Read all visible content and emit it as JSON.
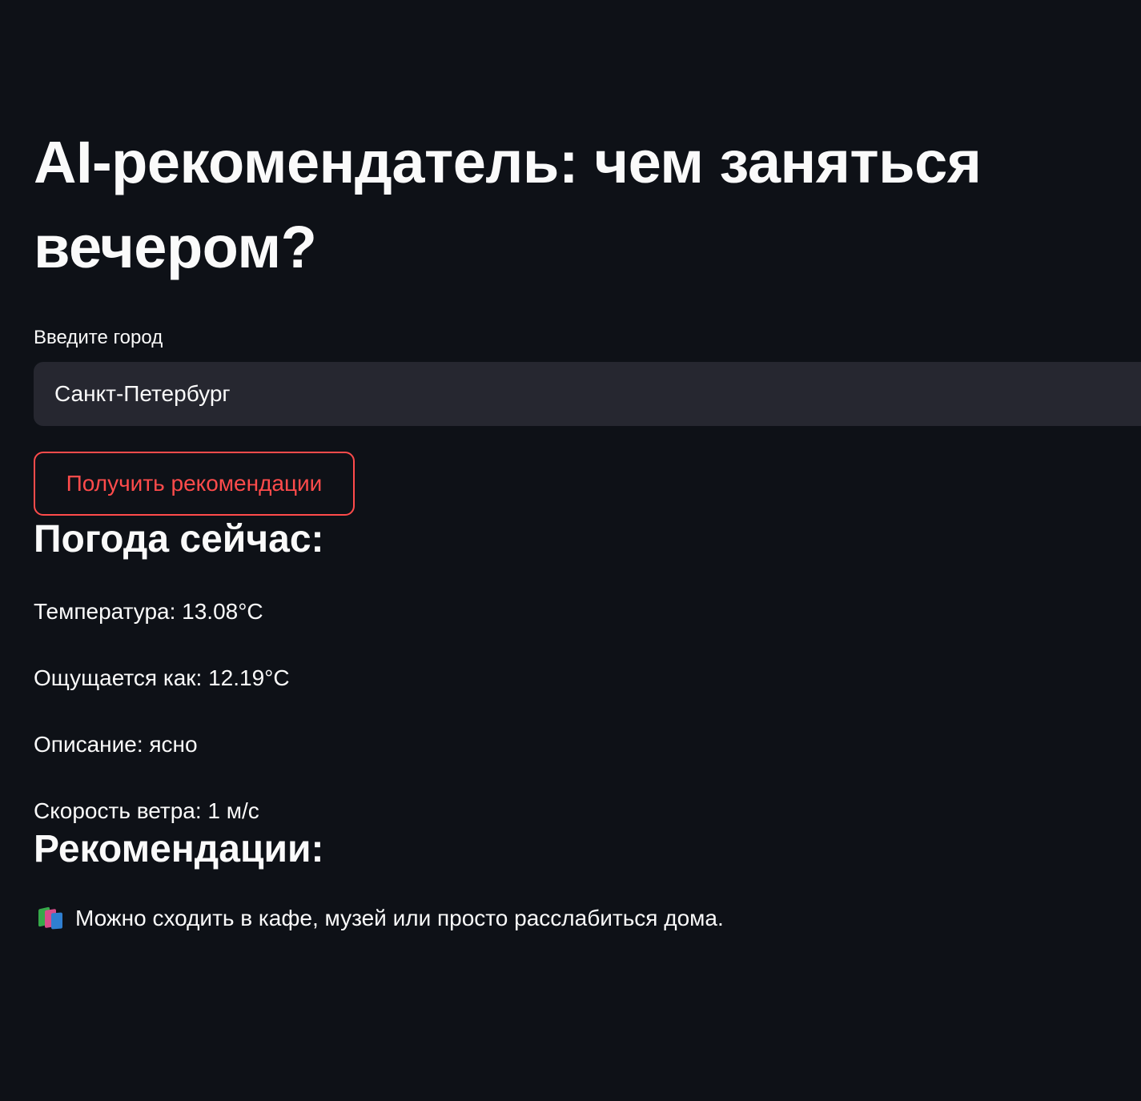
{
  "page": {
    "title": "AI-рекомендатель: чем заняться вечером?"
  },
  "city_input": {
    "label": "Введите город",
    "value": "Санкт-Петербург"
  },
  "actions": {
    "get_recommendations_label": "Получить рекомендации"
  },
  "weather": {
    "heading": "Погода сейчас:",
    "temperature": "Температура: 13.08°C",
    "feels_like": "Ощущается как: 12.19°C",
    "description": "Описание: ясно",
    "wind_speed": "Скорость ветра: 1 м/с"
  },
  "recommendations": {
    "heading": "Рекомендации:",
    "icon": "books-icon",
    "text": "Можно сходить в кафе, музей или просто расслабиться дома."
  },
  "colors": {
    "background": "#0e1117",
    "text": "#fafafa",
    "input_background": "#262730",
    "accent": "#ff4b4b"
  }
}
